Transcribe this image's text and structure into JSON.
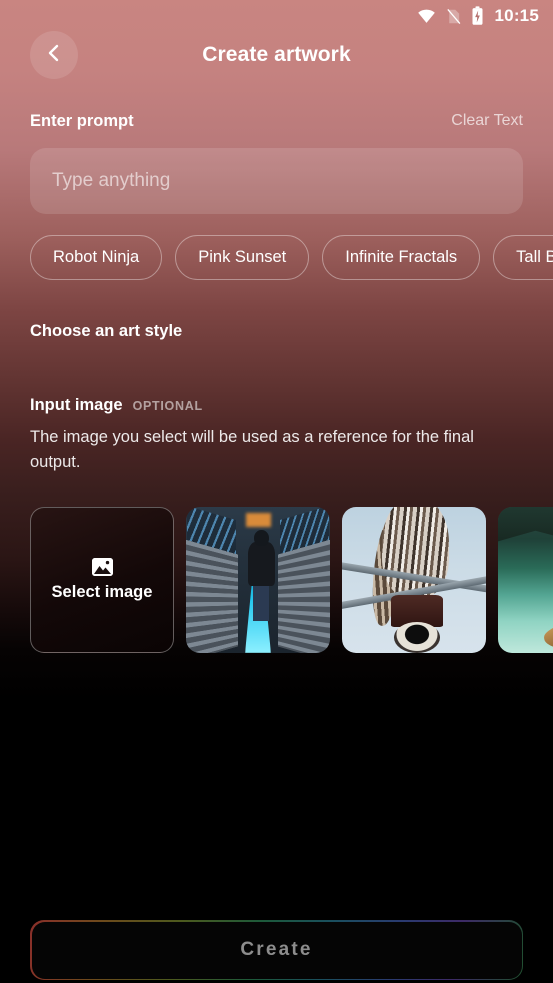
{
  "status_bar": {
    "time": "10:15",
    "icons": [
      "wifi-icon",
      "no-sim-icon",
      "battery-charging-icon"
    ]
  },
  "app_bar": {
    "back_icon": "chevron-left-icon",
    "title": "Create artwork"
  },
  "prompt_section": {
    "label": "Enter prompt",
    "clear_label": "Clear Text",
    "input_value": "",
    "input_placeholder": "Type anything",
    "chips": [
      {
        "label": "Robot Ninja"
      },
      {
        "label": "Pink Sunset"
      },
      {
        "label": "Infinite Fractals"
      },
      {
        "label": "Tall Bird"
      }
    ]
  },
  "art_style_section": {
    "label": "Choose an art style"
  },
  "input_image_section": {
    "label": "Input image",
    "badge": "OPTIONAL",
    "description": "The image you select will be used as a reference for the final output.",
    "select_tile": {
      "icon": "picture-icon",
      "label": "Select image"
    },
    "thumbnails": [
      {
        "name": "escalator-night-photo",
        "alt": "Person in hoodie on neon-lit escalator stairs"
      },
      {
        "name": "owl-on-wire-photo",
        "alt": "Owl perched on power line insulator against pale sky"
      },
      {
        "name": "lake-boat-photo",
        "alt": "Wooden boat on turquoise mountain lake"
      }
    ]
  },
  "footer": {
    "create_label": "Create"
  },
  "colors": {
    "background_top": "#c98581",
    "background_mid": "#5e3230",
    "background_bottom": "#000000",
    "text_primary": "#ffffff",
    "create_text": "#8d8d8d",
    "create_fill": "#050505"
  }
}
